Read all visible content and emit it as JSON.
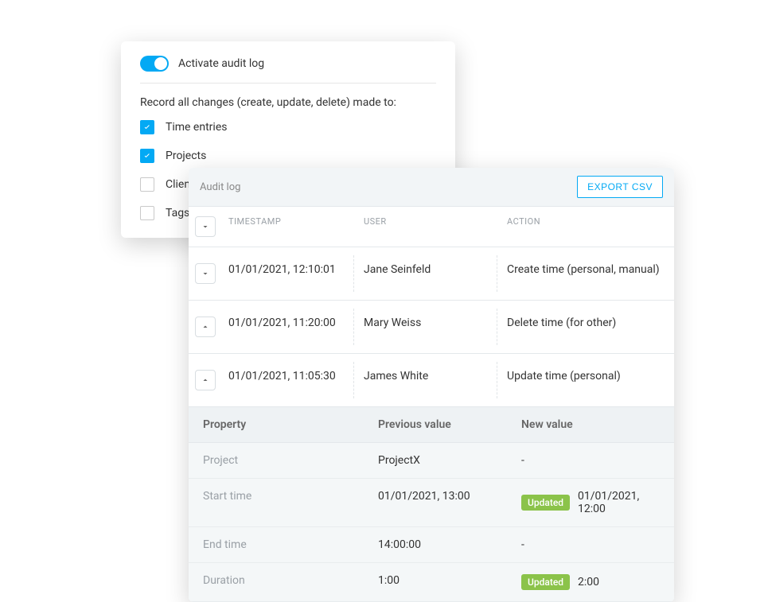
{
  "colors": {
    "accent": "#03A9F4",
    "badge": "#8BC34A"
  },
  "settings": {
    "activate_label": "Activate audit log",
    "record_label": "Record all changes (create, update, delete) made to:",
    "options": [
      {
        "label": "Time entries",
        "checked": true
      },
      {
        "label": "Projects",
        "checked": true
      },
      {
        "label": "Clients",
        "checked": false
      },
      {
        "label": "Tags",
        "checked": false
      }
    ]
  },
  "auditlog": {
    "title": "Audit log",
    "export_label": "EXPORT CSV",
    "columns": {
      "timestamp": "TIMESTAMP",
      "user": "USER",
      "action": "ACTION"
    },
    "rows": [
      {
        "expanded": false,
        "timestamp": "01/01/2021, 12:10:01",
        "user": "Jane Seinfeld",
        "action": "Create time (personal, manual)"
      },
      {
        "expanded": true,
        "timestamp": "01/01/2021, 11:20:00",
        "user": "Mary Weiss",
        "action": "Delete time (for other)"
      },
      {
        "expanded": true,
        "timestamp": "01/01/2021, 11:05:30",
        "user": "James White",
        "action": "Update time (personal)"
      }
    ],
    "detail": {
      "columns": {
        "property": "Property",
        "previous": "Previous value",
        "new": "New value"
      },
      "updated_badge": "Updated",
      "rows": [
        {
          "property": "Project",
          "previous": "ProjectX",
          "new": "-",
          "updated": false
        },
        {
          "property": "Start time",
          "previous": "01/01/2021, 13:00",
          "new": "01/01/2021, 12:00",
          "updated": true
        },
        {
          "property": "End time",
          "previous": "14:00:00",
          "new": "-",
          "updated": false
        },
        {
          "property": "Duration",
          "previous": "1:00",
          "new": "2:00",
          "updated": true
        }
      ]
    }
  }
}
